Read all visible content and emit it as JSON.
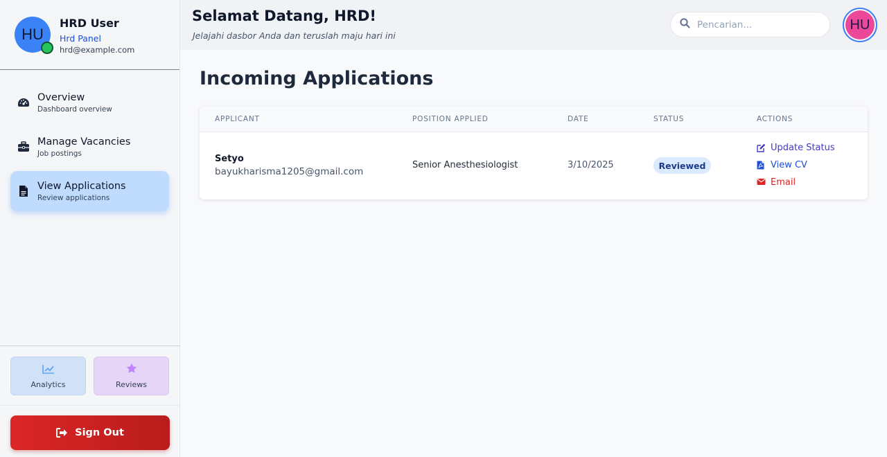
{
  "user": {
    "initials": "HU",
    "name": "HRD User",
    "role": "Hrd Panel",
    "email": "hrd@example.com"
  },
  "nav": [
    {
      "title": "Overview",
      "subtitle": "Dashboard overview",
      "icon": "gauge-icon"
    },
    {
      "title": "Manage Vacancies",
      "subtitle": "Job postings",
      "icon": "briefcase-icon"
    },
    {
      "title": "View Applications",
      "subtitle": "Review applications",
      "icon": "document-icon",
      "active": true
    }
  ],
  "quick_links": {
    "analytics": "Analytics",
    "reviews": "Reviews"
  },
  "sign_out": "Sign Out",
  "header": {
    "greeting": "Selamat Datang, HRD!",
    "subtitle": "Jelajahi dasbor Anda dan teruslah maju hari ini",
    "search_placeholder": "Pencarian...",
    "avatar_initials": "HU"
  },
  "main": {
    "title": "Incoming Applications",
    "columns": [
      "APPLICANT",
      "POSITION APPLIED",
      "DATE",
      "STATUS",
      "ACTIONS"
    ],
    "rows": [
      {
        "name": "Setyo",
        "email": "bayukharisma1205@gmail.com",
        "position": "Senior Anesthesiologist",
        "date": "3/10/2025",
        "status": "Reviewed",
        "actions": {
          "update": "Update Status",
          "cv": "View CV",
          "email": "Email"
        }
      }
    ]
  },
  "colors": {
    "accent": "#3b82f6",
    "active_nav": "#bfdbfe",
    "danger": "#dc2626",
    "action_update": "#4338ca",
    "action_cv": "#1d4ed8",
    "action_email": "#dc2626"
  }
}
